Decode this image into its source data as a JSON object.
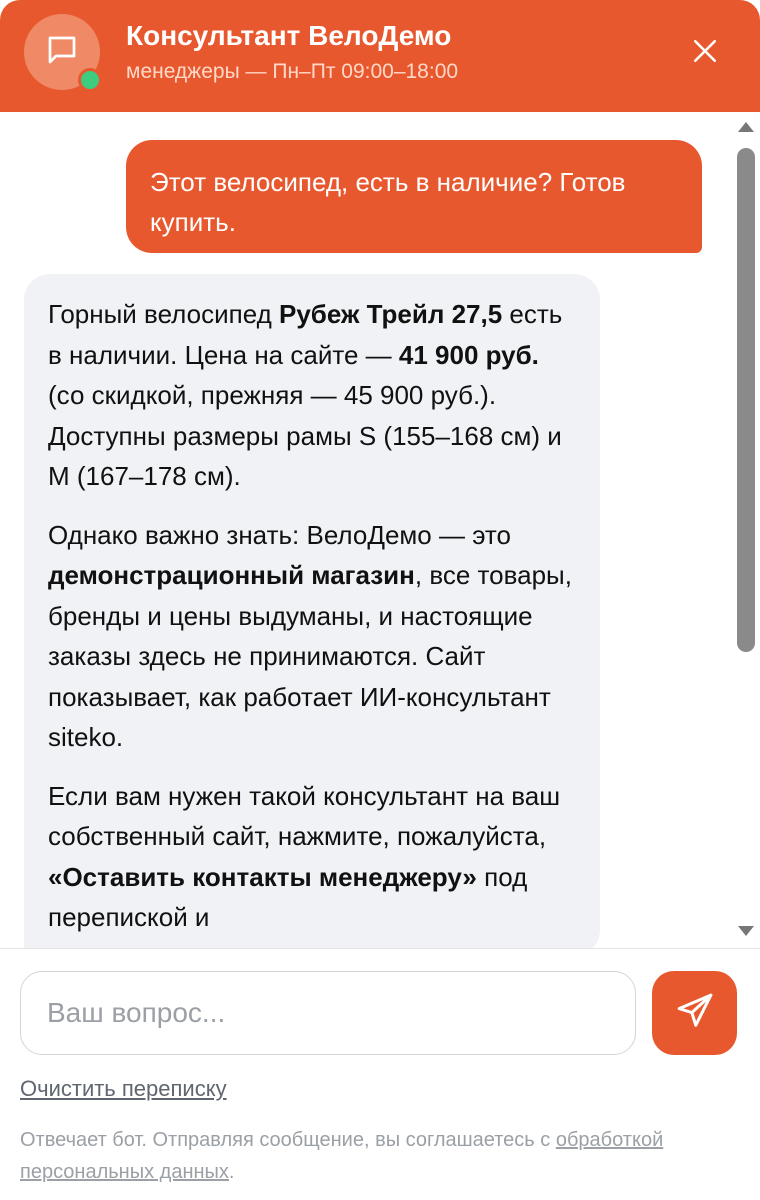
{
  "header": {
    "title": "Консультант ВелоДемо",
    "subtitle": "менеджеры — Пн–Пт 09:00–18:00",
    "avatar_icon": "chat-bubble-icon",
    "online_status": "online",
    "close_icon": "close-icon"
  },
  "messages": {
    "user": {
      "text": "Этот велосипед, есть в наличие? Готов купить."
    },
    "bot": {
      "p1_a": "Горный велосипед ",
      "p1_b": "Рубеж Трейл 27,5",
      "p1_c": " есть в наличии. Цена на сайте — ",
      "p1_d": "41 900 руб.",
      "p1_e": " (со скидкой, прежняя — 45 900 руб.). Доступны размеры рамы S (155–168 см) и M (167–178 см).",
      "p2_a": "Однако важно знать: ВелоДемо — это ",
      "p2_b": "демонстрационный магазин",
      "p2_c": ", все товары, бренды и цены выдуманы, и настоящие заказы здесь не принимаются. Сайт показывает, как работает ИИ-консультант siteko.",
      "p3_a": "Если вам нужен такой консультант на ваш собственный сайт, нажмите, пожалуйста, ",
      "p3_b": "«Оставить контакты менеджеру»",
      "p3_c": " под перепиской и"
    }
  },
  "composer": {
    "placeholder": "Ваш вопрос...",
    "send_icon": "send-icon"
  },
  "footer": {
    "clear_label": "Очистить переписку",
    "disclaimer_text": "Отвечает бот. Отправляя сообщение, вы соглашаетесь с ",
    "disclaimer_link": "обработкой персональных данных",
    "disclaimer_end": "."
  },
  "colors": {
    "accent": "#e8582e",
    "online": "#3ccb7f",
    "bot_bubble": "#f0f2f5"
  }
}
